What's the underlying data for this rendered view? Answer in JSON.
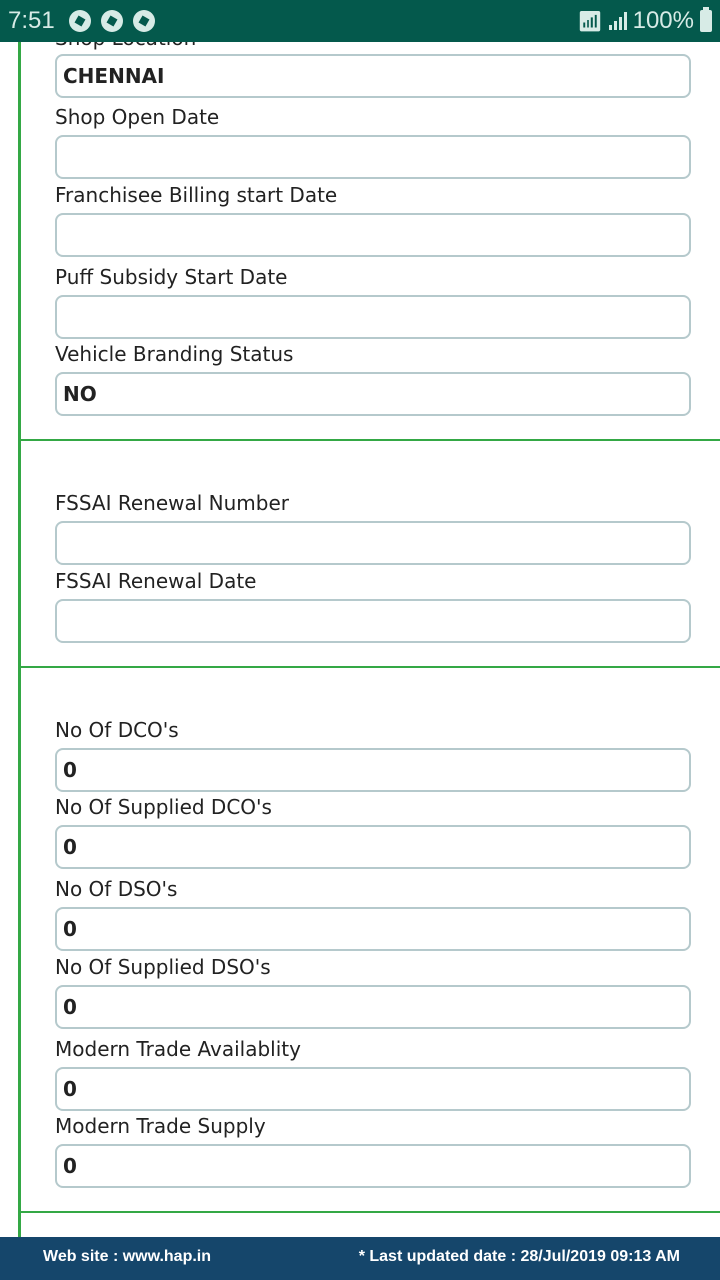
{
  "status_bar": {
    "time": "7:51",
    "battery": "100%",
    "notification_icons": [
      "aperture-icon",
      "aperture-icon",
      "aperture-icon"
    ]
  },
  "sections": [
    {
      "fields": [
        {
          "label": "Shop Location",
          "value": ""
        },
        {
          "label": "",
          "value": "CHENNAI"
        },
        {
          "label": "Shop Open Date",
          "value": ""
        },
        {
          "label": "Franchisee Billing start Date",
          "value": ""
        },
        {
          "label": "Puff Subsidy Start Date",
          "value": ""
        },
        {
          "label": "Vehicle Branding Status",
          "value": "NO"
        }
      ]
    },
    {
      "fields": [
        {
          "label": "FSSAI Renewal Number",
          "value": ""
        },
        {
          "label": "FSSAI Renewal Date",
          "value": ""
        }
      ]
    },
    {
      "fields": [
        {
          "label": "No Of DCO's",
          "value": "0"
        },
        {
          "label": "No Of Supplied DCO's",
          "value": "0"
        },
        {
          "label": "No Of DSO's",
          "value": "0"
        },
        {
          "label": "No Of Supplied DSO's",
          "value": "0"
        },
        {
          "label": "Modern Trade Availablity",
          "value": "0"
        },
        {
          "label": "Modern Trade Supply",
          "value": "0"
        }
      ]
    }
  ],
  "footer": {
    "website": "Web site : www.hap.in",
    "last_updated": "* Last updated date : 28/Jul/2019 09:13 AM"
  },
  "colors": {
    "status_bar": "#04594c",
    "accent_green": "#34a845",
    "footer": "#15466b",
    "field_border": "#b5c9cc"
  }
}
